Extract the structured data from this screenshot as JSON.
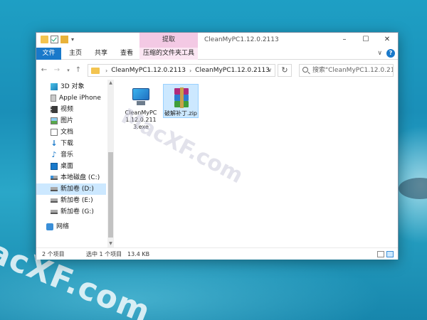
{
  "window": {
    "title": "CleanMyPC1.12.0.2113",
    "context_tab_head": "提取",
    "caption": {
      "minimize": "–",
      "maximize": "☐",
      "close": "✕"
    }
  },
  "ribbon": {
    "tabs": [
      "文件",
      "主页",
      "共享",
      "查看",
      "压缩的文件夹工具"
    ],
    "help": "?"
  },
  "address": {
    "crumbs": [
      "CleanMyPC1.12.0.2113",
      "CleanMyPC1.12.0.2113"
    ],
    "search_placeholder": "搜索\"CleanMyPC1.12.0.21..."
  },
  "nav": {
    "items": [
      {
        "label": "3D 对象",
        "icon": "cube-icon"
      },
      {
        "label": "Apple iPhone",
        "icon": "phone-icon"
      },
      {
        "label": "视频",
        "icon": "video-icon"
      },
      {
        "label": "图片",
        "icon": "picture-icon"
      },
      {
        "label": "文档",
        "icon": "document-icon"
      },
      {
        "label": "下载",
        "icon": "download-icon"
      },
      {
        "label": "音乐",
        "icon": "music-icon"
      },
      {
        "label": "桌面",
        "icon": "desktop-icon"
      },
      {
        "label": "本地磁盘 (C:)",
        "icon": "drive-c-icon"
      },
      {
        "label": "新加卷 (D:)",
        "icon": "drive-icon"
      },
      {
        "label": "新加卷 (E:)",
        "icon": "drive-icon"
      },
      {
        "label": "新加卷 (G:)",
        "icon": "drive-icon"
      },
      {
        "label": "网络",
        "icon": "network-icon"
      }
    ],
    "selected_index": 9
  },
  "files": [
    {
      "name": "CleanMyPC1.12.0.2113.exe",
      "icon": "installer-icon",
      "selected": false
    },
    {
      "name": "破解补丁.zip",
      "icon": "winrar-archive-icon",
      "selected": true
    }
  ],
  "status": {
    "item_count": "2 个项目",
    "selected": "选中 1 个项目",
    "size": "13.4 KB"
  },
  "watermark": {
    "large": "acXF.com",
    "small": "MacXF.com"
  },
  "colors": {
    "accent": "#1979ca",
    "context_tab": "#f3c9e4",
    "selection": "#cce8ff"
  }
}
